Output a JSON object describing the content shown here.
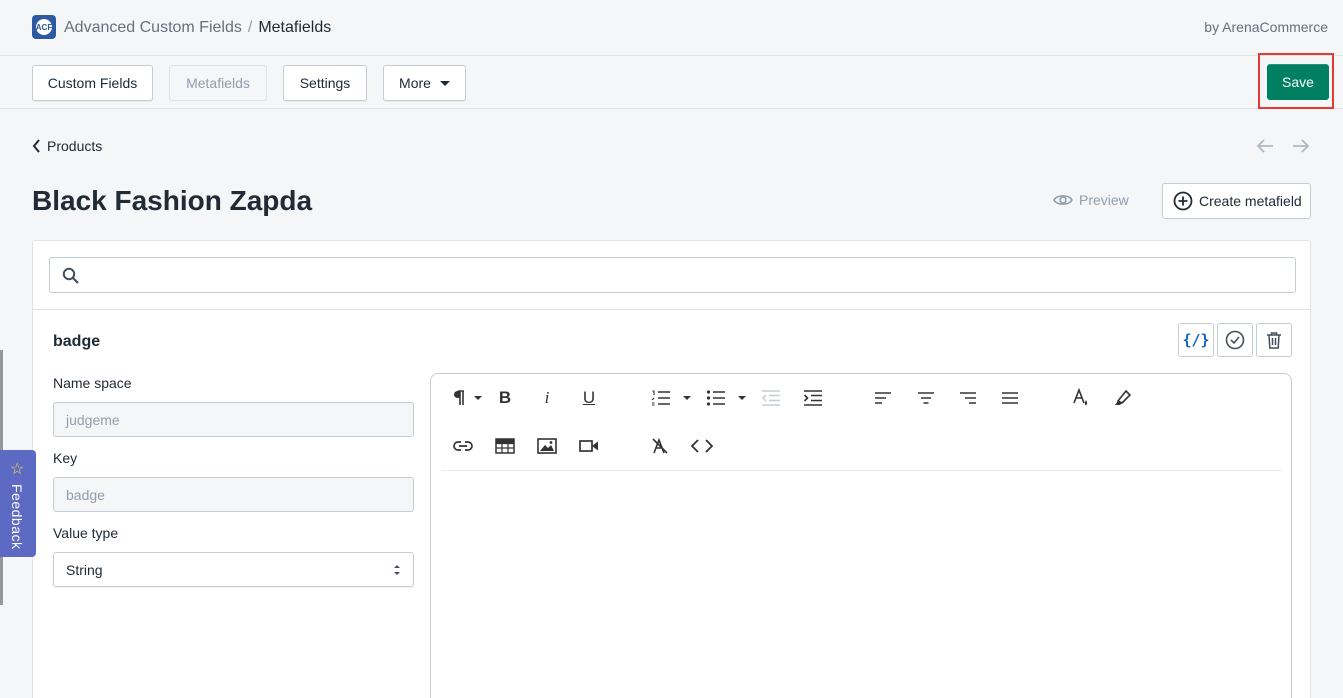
{
  "header": {
    "app_name": "Advanced Custom Fields",
    "separator": "/",
    "current_section": "Metafields",
    "vendor": "by ArenaCommerce",
    "logo_text": "ACF"
  },
  "toolbar": {
    "custom_fields_label": "Custom Fields",
    "metafields_label": "Metafields",
    "settings_label": "Settings",
    "more_label": "More",
    "save_label": "Save"
  },
  "page": {
    "back_label": "Products",
    "title": "Black Fashion Zapda",
    "preview_label": "Preview",
    "create_label": "Create metafield"
  },
  "search": {
    "placeholder": "",
    "value": ""
  },
  "field": {
    "name": "badge",
    "namespace_label": "Name space",
    "namespace_value": "judgeme",
    "key_label": "Key",
    "key_value": "badge",
    "value_type_label": "Value type",
    "value_type_value": "String",
    "code_toggle_label": "{/}"
  },
  "feedback": {
    "label": "Feedback"
  },
  "colors": {
    "primary": "#008060",
    "highlight_border": "#e53935",
    "feedback_bg": "#5c6ac4",
    "code_icon": "#1565c0"
  },
  "icons": {
    "back": "chevron-left-icon",
    "prev": "arrow-left-icon",
    "next": "arrow-right-icon",
    "preview": "eye-icon",
    "create": "plus-circle-icon",
    "search": "search-icon",
    "code": "code-braces-icon",
    "validate": "check-circle-icon",
    "delete": "trash-icon"
  }
}
